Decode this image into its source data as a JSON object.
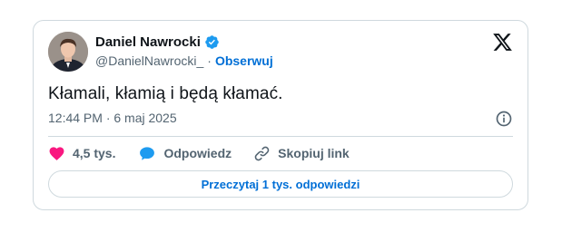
{
  "author": {
    "name": "Daniel Nawrocki",
    "handle": "@DanielNawrocki_",
    "separator": "·",
    "follow_label": "Obserwuj",
    "verified": true
  },
  "tweet": {
    "text": "Kłamali, kłamią i będą kłamać.",
    "timestamp": "12:44 PM · 6 maj 2025"
  },
  "actions": {
    "likes": "4,5 tys.",
    "reply_label": "Odpowiedz",
    "copy_link_label": "Skopiuj link"
  },
  "read_replies_label": "Przeczytaj 1 tys. odpowiedzi",
  "icons": {
    "verified": "verified-badge-icon",
    "brand": "x-logo-icon",
    "info": "info-icon",
    "like": "heart-icon",
    "reply": "speech-bubble-icon",
    "link": "link-icon"
  },
  "colors": {
    "accent": "#006fd6",
    "like": "#f91880",
    "reply": "#1d9bf0",
    "verified": "#1d9bf0",
    "secondary_text": "#536471",
    "border": "#cfd9de"
  }
}
